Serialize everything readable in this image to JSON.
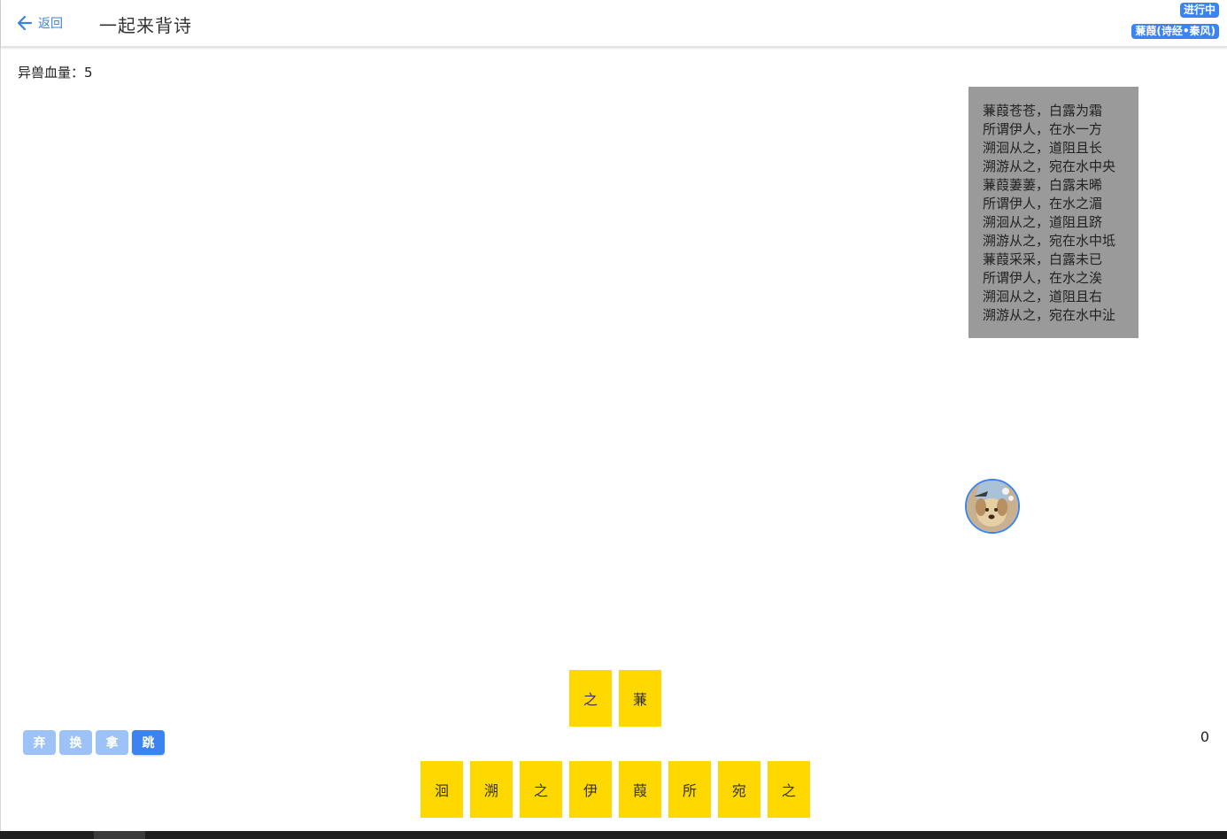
{
  "header": {
    "back_label": "返回",
    "title": "一起来背诗",
    "status": "进行中",
    "poem_name": "蒹葭(诗经•秦风)"
  },
  "game": {
    "hp_label": "异兽血量：5",
    "poem_lines": [
      "蒹葭苍苍，白露为霜",
      "所谓伊人，在水一方",
      "溯洄从之，道阻且长",
      "溯游从之，宛在水中央",
      "蒹葭萋萋，白露未晞",
      "所谓伊人，在水之湄",
      "溯洄从之，道阻且跻",
      "溯游从之，宛在水中坻",
      "蒹葭采采，白露未已",
      "所谓伊人，在水之涘",
      "溯洄从之，道阻且右",
      "溯游从之，宛在水中沚"
    ],
    "collected_chars": [
      "之",
      "蒹"
    ],
    "hand_chars": [
      "洄",
      "溯",
      "之",
      "伊",
      "葭",
      "所",
      "宛",
      "之"
    ],
    "actions": {
      "discard": "弃",
      "swap": "换",
      "take": "拿",
      "jump": "跳"
    },
    "score": "0"
  },
  "colors": {
    "accent": "#3a83f0",
    "tile": "#ffd800",
    "poem_box": "#9a9a9a",
    "button_faded": "#9cc2f8"
  }
}
